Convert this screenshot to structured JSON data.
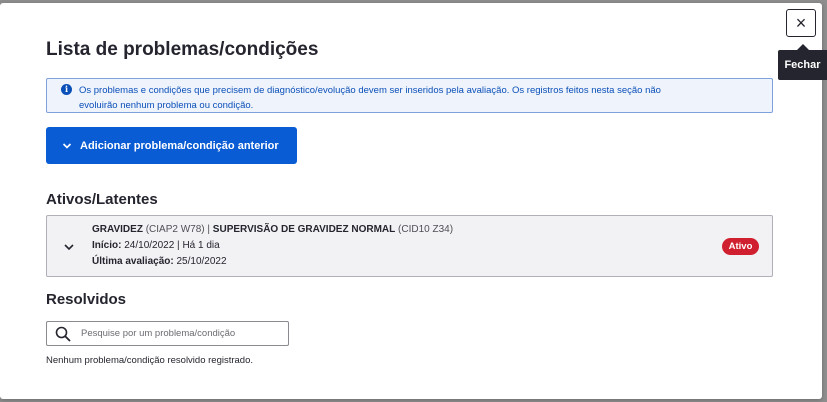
{
  "modal": {
    "title": "Lista de problemas/condições",
    "close_label": "×",
    "close_tooltip": "Fechar"
  },
  "alert": {
    "icon": "info-icon",
    "icon_glyph": "i",
    "line1": "Os problemas e condições que precisem de diagnóstico/evolução devem ser inseridos pela avaliação. Os registros feitos nesta seção não",
    "line2": "evoluirão nenhum problema ou condição."
  },
  "add_button": {
    "label": "Adicionar problema/condição anterior"
  },
  "active_section": {
    "title": "Ativos/Latentes",
    "items": [
      {
        "name": "GRAVIDEZ",
        "code": "(CIAP2 W78)",
        "separator": "|",
        "name2": "SUPERVISÃO DE GRAVIDEZ NORMAL",
        "code2": "(CID10 Z34)",
        "start_label": "Início:",
        "start_value": "24/10/2022 | Há 1 dia",
        "last_eval_label": "Última avaliação:",
        "last_eval_value": "25/10/2022",
        "status": "Ativo"
      }
    ]
  },
  "resolved_section": {
    "title": "Resolvidos",
    "search_placeholder": "Pesquise por um problema/condição",
    "empty_message": "Nenhum problema/condição resolvido registrado."
  },
  "colors": {
    "primary": "#0a5cd4",
    "alert_bg": "#eef3fc",
    "alert_text": "#0b50b8",
    "badge_red": "#d01f2e",
    "tooltip_bg": "#24252e"
  }
}
